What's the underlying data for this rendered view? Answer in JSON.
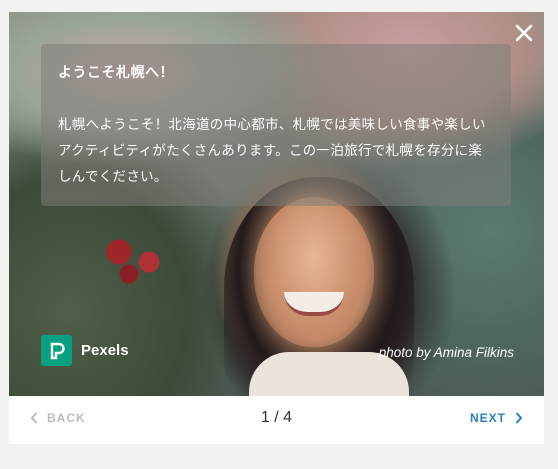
{
  "tour": {
    "title": "ようこそ札幌へ！",
    "body": "札幌へようこそ！北海道の中心都市、札幌では美味しい食事や楽しいアクティビティがたくさんあります。この一泊旅行で札幌を存分に楽しんでください。"
  },
  "photo": {
    "brand": "Pexels",
    "credit": "photo by Amina Filkins"
  },
  "footer": {
    "back_label": "BACK",
    "pager": "1 / 4",
    "next_label": "NEXT"
  },
  "colors": {
    "next_accent": "#2a7fc3",
    "back_disabled": "#b9bcc4",
    "pexels_brand": "#07a081"
  },
  "icons": {
    "close": "close-icon",
    "back": "chevron-left-icon",
    "next": "chevron-right-icon",
    "pexels": "pexels-logo-icon"
  }
}
